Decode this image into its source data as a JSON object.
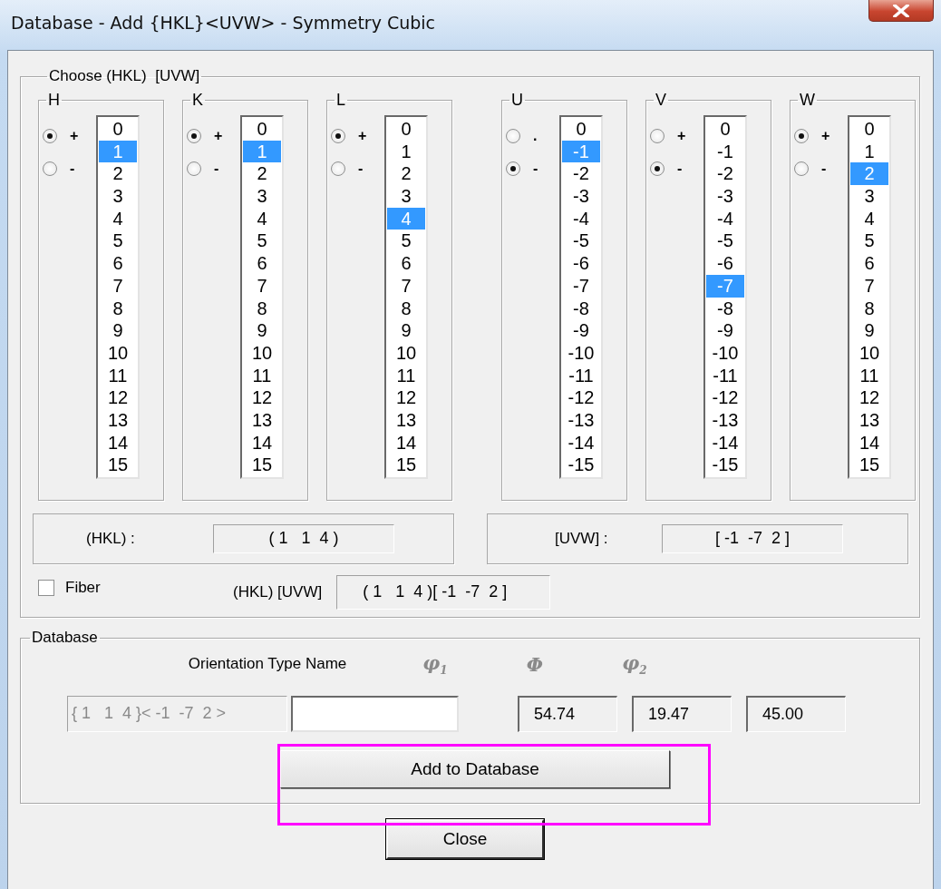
{
  "window": {
    "title": "Database - Add {HKL}<UVW> - Symmetry Cubic"
  },
  "choose": {
    "title": "Choose (HKL)  [UVW]",
    "indices": [
      {
        "label": "H",
        "signs": [
          {
            "label": "+",
            "selected": true
          },
          {
            "label": "-",
            "selected": false
          }
        ],
        "values": [
          {
            "text": "0",
            "selected": false
          },
          {
            "text": "1",
            "selected": true
          },
          {
            "text": "2",
            "selected": false
          },
          {
            "text": "3",
            "selected": false
          },
          {
            "text": "4",
            "selected": false
          },
          {
            "text": "5",
            "selected": false
          },
          {
            "text": "6",
            "selected": false
          },
          {
            "text": "7",
            "selected": false
          },
          {
            "text": "8",
            "selected": false
          },
          {
            "text": "9",
            "selected": false
          },
          {
            "text": "10",
            "selected": false
          },
          {
            "text": "11",
            "selected": false
          },
          {
            "text": "12",
            "selected": false
          },
          {
            "text": "13",
            "selected": false
          },
          {
            "text": "14",
            "selected": false
          },
          {
            "text": "15",
            "selected": false
          }
        ]
      },
      {
        "label": "K",
        "signs": [
          {
            "label": "+",
            "selected": true
          },
          {
            "label": "-",
            "selected": false
          }
        ],
        "values": [
          {
            "text": "0",
            "selected": false
          },
          {
            "text": "1",
            "selected": true
          },
          {
            "text": "2",
            "selected": false
          },
          {
            "text": "3",
            "selected": false
          },
          {
            "text": "4",
            "selected": false
          },
          {
            "text": "5",
            "selected": false
          },
          {
            "text": "6",
            "selected": false
          },
          {
            "text": "7",
            "selected": false
          },
          {
            "text": "8",
            "selected": false
          },
          {
            "text": "9",
            "selected": false
          },
          {
            "text": "10",
            "selected": false
          },
          {
            "text": "11",
            "selected": false
          },
          {
            "text": "12",
            "selected": false
          },
          {
            "text": "13",
            "selected": false
          },
          {
            "text": "14",
            "selected": false
          },
          {
            "text": "15",
            "selected": false
          }
        ]
      },
      {
        "label": "L",
        "signs": [
          {
            "label": "+",
            "selected": true
          },
          {
            "label": "-",
            "selected": false
          }
        ],
        "values": [
          {
            "text": "0",
            "selected": false
          },
          {
            "text": "1",
            "selected": false
          },
          {
            "text": "2",
            "selected": false
          },
          {
            "text": "3",
            "selected": false
          },
          {
            "text": "4",
            "selected": true
          },
          {
            "text": "5",
            "selected": false
          },
          {
            "text": "6",
            "selected": false
          },
          {
            "text": "7",
            "selected": false
          },
          {
            "text": "8",
            "selected": false
          },
          {
            "text": "9",
            "selected": false
          },
          {
            "text": "10",
            "selected": false
          },
          {
            "text": "11",
            "selected": false
          },
          {
            "text": "12",
            "selected": false
          },
          {
            "text": "13",
            "selected": false
          },
          {
            "text": "14",
            "selected": false
          },
          {
            "text": "15",
            "selected": false
          }
        ]
      },
      {
        "label": "U",
        "signs": [
          {
            "label": ".",
            "selected": false
          },
          {
            "label": "-",
            "selected": true
          }
        ],
        "values": [
          {
            "text": "0",
            "selected": false
          },
          {
            "text": "-1",
            "selected": true
          },
          {
            "text": "-2",
            "selected": false
          },
          {
            "text": "-3",
            "selected": false
          },
          {
            "text": "-4",
            "selected": false
          },
          {
            "text": "-5",
            "selected": false
          },
          {
            "text": "-6",
            "selected": false
          },
          {
            "text": "-7",
            "selected": false
          },
          {
            "text": "-8",
            "selected": false
          },
          {
            "text": "-9",
            "selected": false
          },
          {
            "text": "-10",
            "selected": false
          },
          {
            "text": "-11",
            "selected": false
          },
          {
            "text": "-12",
            "selected": false
          },
          {
            "text": "-13",
            "selected": false
          },
          {
            "text": "-14",
            "selected": false
          },
          {
            "text": "-15",
            "selected": false
          }
        ]
      },
      {
        "label": "V",
        "signs": [
          {
            "label": "+",
            "selected": false
          },
          {
            "label": "-",
            "selected": true
          }
        ],
        "values": [
          {
            "text": "0",
            "selected": false
          },
          {
            "text": "-1",
            "selected": false
          },
          {
            "text": "-2",
            "selected": false
          },
          {
            "text": "-3",
            "selected": false
          },
          {
            "text": "-4",
            "selected": false
          },
          {
            "text": "-5",
            "selected": false
          },
          {
            "text": "-6",
            "selected": false
          },
          {
            "text": "-7",
            "selected": true
          },
          {
            "text": "-8",
            "selected": false
          },
          {
            "text": "-9",
            "selected": false
          },
          {
            "text": "-10",
            "selected": false
          },
          {
            "text": "-11",
            "selected": false
          },
          {
            "text": "-12",
            "selected": false
          },
          {
            "text": "-13",
            "selected": false
          },
          {
            "text": "-14",
            "selected": false
          },
          {
            "text": "-15",
            "selected": false
          }
        ]
      },
      {
        "label": "W",
        "signs": [
          {
            "label": "+",
            "selected": true
          },
          {
            "label": "-",
            "selected": false
          }
        ],
        "values": [
          {
            "text": "0",
            "selected": false
          },
          {
            "text": "1",
            "selected": false
          },
          {
            "text": "2",
            "selected": true
          },
          {
            "text": "3",
            "selected": false
          },
          {
            "text": "4",
            "selected": false
          },
          {
            "text": "5",
            "selected": false
          },
          {
            "text": "6",
            "selected": false
          },
          {
            "text": "7",
            "selected": false
          },
          {
            "text": "8",
            "selected": false
          },
          {
            "text": "9",
            "selected": false
          },
          {
            "text": "10",
            "selected": false
          },
          {
            "text": "11",
            "selected": false
          },
          {
            "text": "12",
            "selected": false
          },
          {
            "text": "13",
            "selected": false
          },
          {
            "text": "14",
            "selected": false
          },
          {
            "text": "15",
            "selected": false
          }
        ]
      }
    ],
    "results": [
      {
        "label": "(HKL) :",
        "value": "( 1   1  4 )"
      },
      {
        "label": "[UVW] :",
        "value": "[ -1  -7  2 ]"
      }
    ],
    "fiber": {
      "label": "Fiber",
      "checked": false
    },
    "combined": {
      "label": "(HKL) [UVW]",
      "value": "( 1   1  4 )[ -1  -7  2 ]"
    }
  },
  "database": {
    "title": "Database",
    "name_header": "Orientation Type Name",
    "orientation": "{ 1   1  4 }< -1  -7  2 >",
    "angles": [
      {
        "header": "φ$_{1}$",
        "value": "54.74"
      },
      {
        "header": "Φ",
        "value": "19.47"
      },
      {
        "header": "φ$_{2}$",
        "value": "45.00"
      }
    ],
    "add_button": "Add to Database"
  },
  "close_button": "Close"
}
